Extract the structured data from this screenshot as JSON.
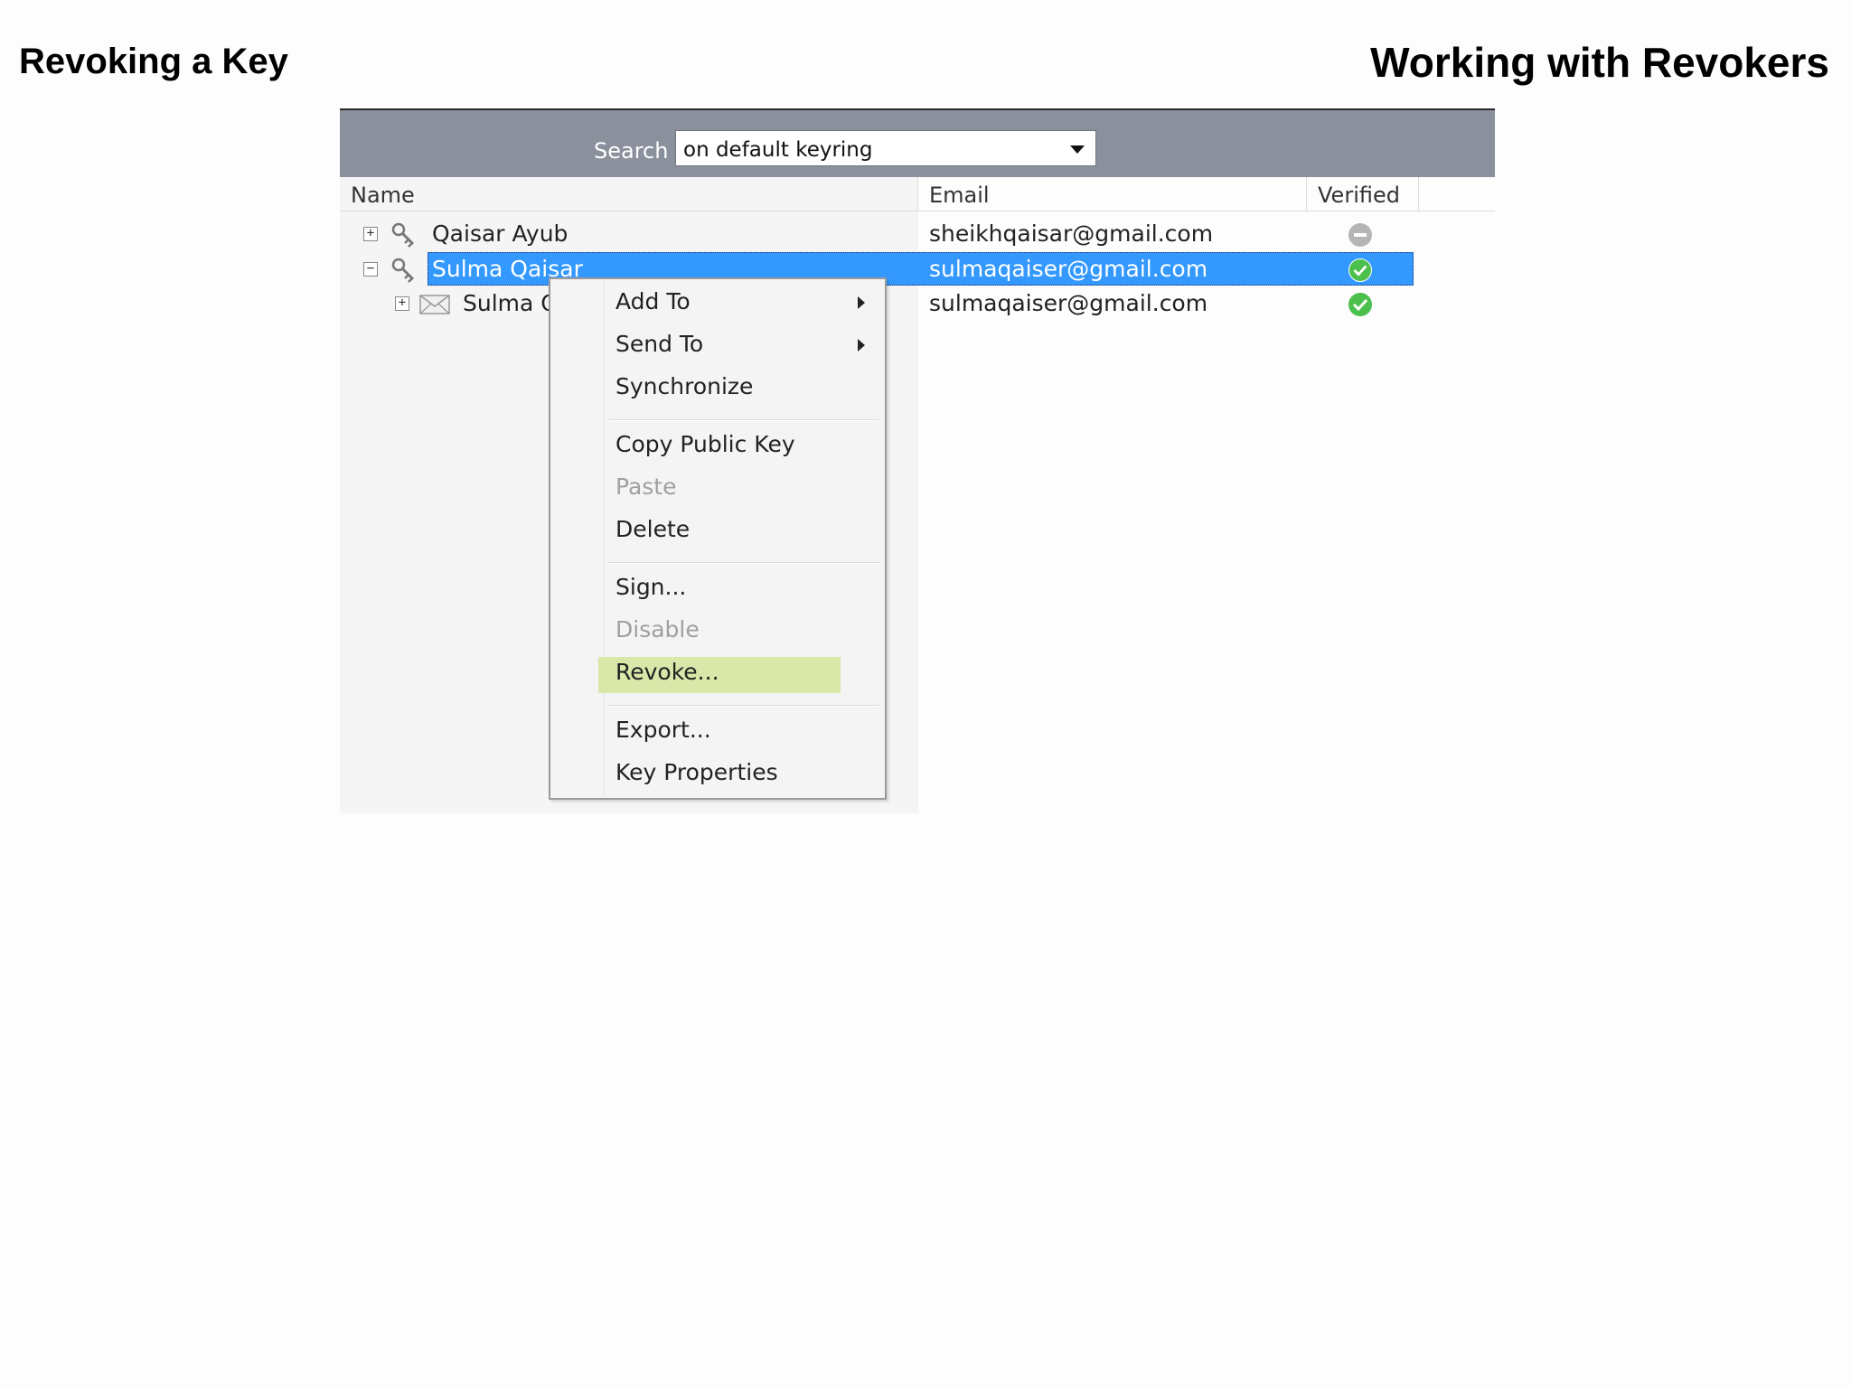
{
  "slide": {
    "title_left": "Revoking a Key",
    "title_right": "Working with Revokers"
  },
  "search": {
    "label": "Search",
    "selected_value": "on default keyring"
  },
  "columns": {
    "name": "Name",
    "email": "Email",
    "verified": "Verified"
  },
  "rows": [
    {
      "name": "Qaisar Ayub",
      "email": "sheikhqaisar@gmail.com",
      "verified": "neutral",
      "expander": "+",
      "icon": "key-icon",
      "selected": false
    },
    {
      "name": "Sulma Qaisar",
      "email": "sulmaqaiser@gmail.com",
      "verified": "valid",
      "expander": "−",
      "icon": "key-icon",
      "selected": true
    },
    {
      "name": "Sulma Q",
      "email": "sulmaqaiser@gmail.com",
      "verified": "valid",
      "expander": "+",
      "icon": "mail-icon",
      "selected": false
    }
  ],
  "context_menu": {
    "add_to": "Add To",
    "send_to": "Send To",
    "synchronize": "Synchronize",
    "copy_public_key": "Copy Public Key",
    "paste": "Paste",
    "delete": "Delete",
    "sign": "Sign...",
    "disable": "Disable",
    "revoke": "Revoke...",
    "export": "Export...",
    "key_properties": "Key Properties"
  },
  "colors": {
    "toolbar_bg": "#8a909c",
    "selection": "#3399ff",
    "menu_highlight": "#d9e7a9",
    "verified_green": "#4cc04c",
    "neutral_gray": "#b5b5b5"
  }
}
